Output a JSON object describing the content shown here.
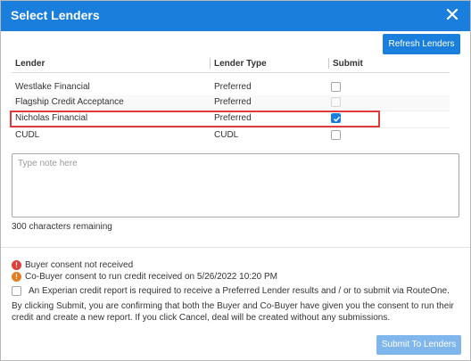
{
  "dialog": {
    "title": "Select Lenders",
    "close_icon": "close-icon",
    "accent_color": "#1a7fdc"
  },
  "toolbar": {
    "refresh_label": "Refresh Lenders"
  },
  "table": {
    "headers": [
      "Lender",
      "Lender Type",
      "Submit"
    ],
    "rows": [
      {
        "lender": "Westlake Financial",
        "type": "Preferred",
        "submit": "unchecked"
      },
      {
        "lender": "Flagship Credit Acceptance",
        "type": "Preferred",
        "submit": "disabled"
      },
      {
        "lender": "Nicholas Financial",
        "type": "Preferred",
        "submit": "checked"
      },
      {
        "lender": "CUDL",
        "type": "CUDL",
        "submit": "unchecked"
      }
    ]
  },
  "note": {
    "placeholder": "Type note here",
    "value": "",
    "chars_remaining": "300 characters remaining"
  },
  "warnings": [
    {
      "icon": "error-icon",
      "text": "Buyer consent not received",
      "color": "#e2403a"
    },
    {
      "icon": "warning-icon",
      "text": "Co-Buyer consent to run credit received on 5/26/2022 10:20 PM",
      "color": "#e87c22"
    }
  ],
  "consent": {
    "checkbox_label": "An Experian credit report is required to receive a Preferred Lender results and / or to submit via RouteOne.",
    "disclaimer": "By clicking Submit, you are confirming that both the Buyer and Co-Buyer have given you the consent to run their credit and create a new report. If you click Cancel, deal will be created without any submissions."
  },
  "footer": {
    "submit_label": "Submit To Lenders"
  }
}
